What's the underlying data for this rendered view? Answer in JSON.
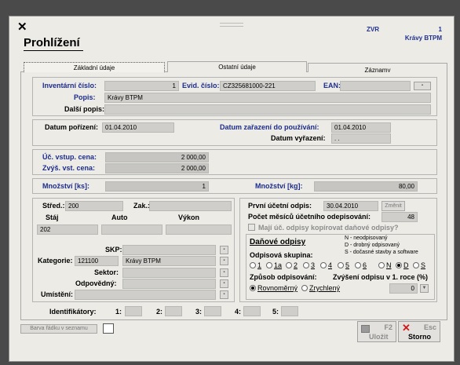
{
  "window": {
    "title": "Prohlížení",
    "code": "ZVR",
    "record_no": "1",
    "record_name": "Krávy BTPM"
  },
  "tabs": [
    {
      "label": "Základní údaje"
    },
    {
      "label": "Ostatní údaje"
    },
    {
      "label": "Záznamy"
    }
  ],
  "top": {
    "inv_label": "Inventární číslo:",
    "inv_value": "1",
    "evid_label": "Evid. číslo:",
    "evid_value": "CZ325681000-221",
    "ean_label": "EAN:",
    "ean_value": "",
    "popis_label": "Popis:",
    "popis_value": "Krávy BTPM",
    "dalsi_label": "Další popis:",
    "dalsi_value": ""
  },
  "dates": {
    "porizeni_label": "Datum pořízení:",
    "porizeni_value": "01.04.2010",
    "zarazeni_label": "Datum zařazení do používání:",
    "zarazeni_value": "01.04.2010",
    "vyrazeni_label": "Datum vyřazení:",
    "vyrazeni_value": ". ."
  },
  "prices": {
    "vstup_label": "Úč. vstup. cena:",
    "vstup_value": "2 000,00",
    "zvys_label": "Zvýš. vst. cena:",
    "zvys_value": "2 000,00"
  },
  "qty": {
    "ks_label": "Množství [ks]:",
    "ks_value": "1",
    "kg_label": "Množství [kg]:",
    "kg_value": "80,00"
  },
  "left": {
    "stred_label": "Střed.:",
    "stred_value": "200",
    "zak_label": "Zak.:",
    "zak_value": "",
    "stáj_label": "Stáj",
    "auto_label": "Auto",
    "vykon_label": "Výkon",
    "staj_value": "202",
    "skp_label": "SKP:",
    "skp_value": "",
    "kategorie_label": "Kategorie:",
    "kategorie_code": "121100",
    "kategorie_name": "Krávy BTPM",
    "sektor_label": "Sektor:",
    "sektor_value": "",
    "odpovedny_label": "Odpovědný:",
    "odpovedny_value": "",
    "umisteni_label": "Umístění:",
    "umisteni_value": ""
  },
  "right": {
    "prvni_label": "První účetní odpis:",
    "prvni_value": "30.04.2010",
    "zmenit_label": "Změnit",
    "pocet_label": "Počet měsíců účetního odepisování:",
    "pocet_value": "48",
    "copy_label": "Mají úč. odpisy kopírovat daňové odpisy?",
    "danove_title": "Daňové odpisy",
    "legend_n": "N - neodpisovaný",
    "legend_d": "D - drobný odpisovaný",
    "legend_s": "S - dočasné stavby a software",
    "skupina_label": "Odpisová skupina:",
    "groups": [
      "1",
      "1a",
      "2",
      "3",
      "4",
      "5",
      "6",
      "N",
      "D",
      "S"
    ],
    "zpusob_label": "Způsob odpisování:",
    "zvyseni_label": "Zvýšení odpisu v 1. roce (%)",
    "rovnomerny": "Rovnoměrný",
    "zrychleny": "Zrychlený",
    "zvyseni_value": "0"
  },
  "ident": {
    "label": "Identifikátory:",
    "fields": [
      {
        "n": "1:"
      },
      {
        "n": "2:"
      },
      {
        "n": "3:"
      },
      {
        "n": "4:"
      },
      {
        "n": "5:"
      }
    ]
  },
  "footer": {
    "barva_label": "Barva řádku v seznamu",
    "ulozit_key": "F2",
    "ulozit_label": "Uložit",
    "storno_key": "Esc",
    "storno_label": "Storno"
  }
}
